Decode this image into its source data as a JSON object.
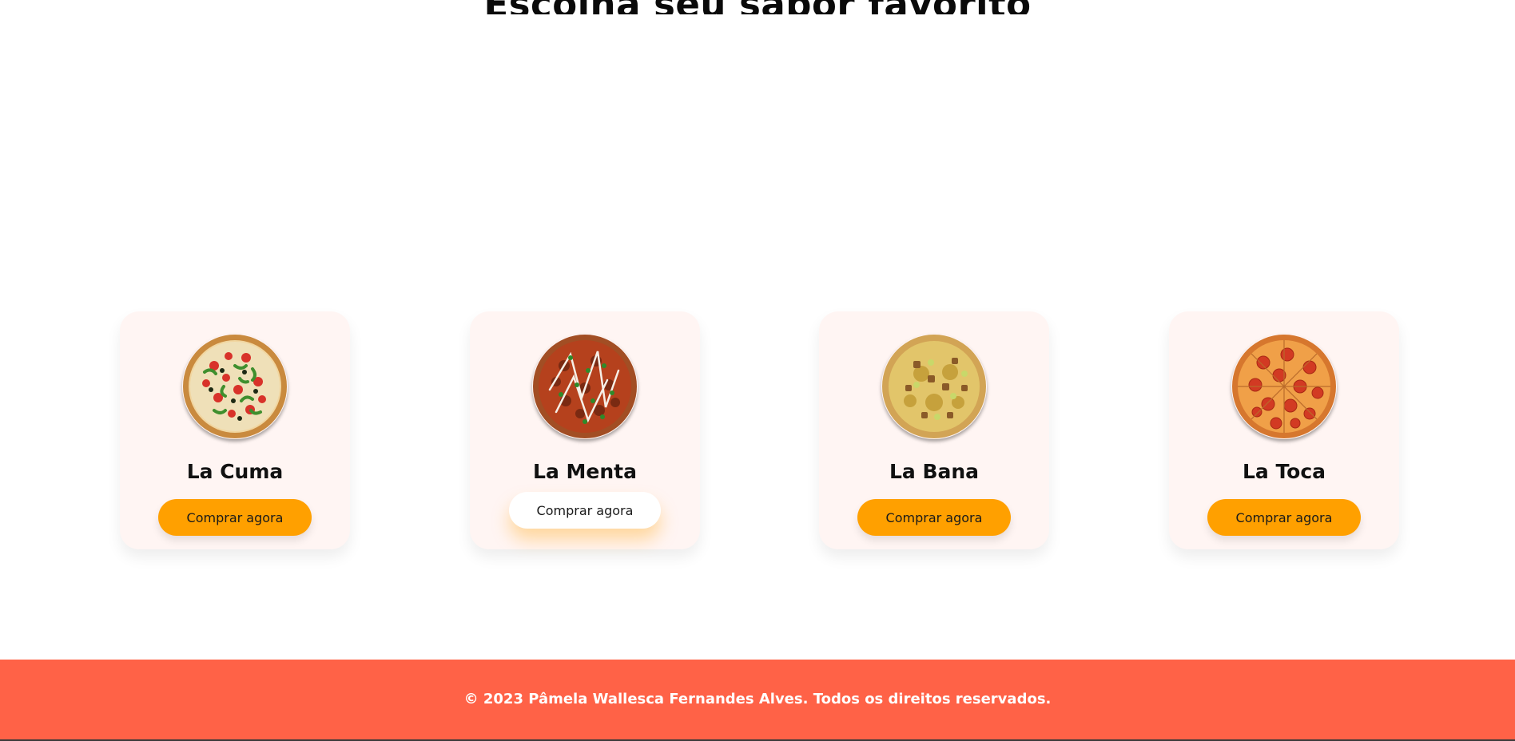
{
  "section": {
    "title": "Escolha seu sabor favorito"
  },
  "products": [
    {
      "name": "La Cuma",
      "button_label": "Comprar agora",
      "image": "pizza-vegetable"
    },
    {
      "name": "La Menta",
      "button_label": "Comprar agora",
      "image": "pizza-bbq-drizzle"
    },
    {
      "name": "La Bana",
      "button_label": "Comprar agora",
      "image": "pizza-cheese-chunks"
    },
    {
      "name": "La Toca",
      "button_label": "Comprar agora",
      "image": "pizza-pepperoni"
    }
  ],
  "footer": {
    "copyright": "© 2023 Pâmela Wallesca Fernandes Alves. Todos os direitos reservados."
  },
  "colors": {
    "accent": "#ffa000",
    "footer_bg": "#ff6247",
    "card_bg": "#fff5f3"
  }
}
